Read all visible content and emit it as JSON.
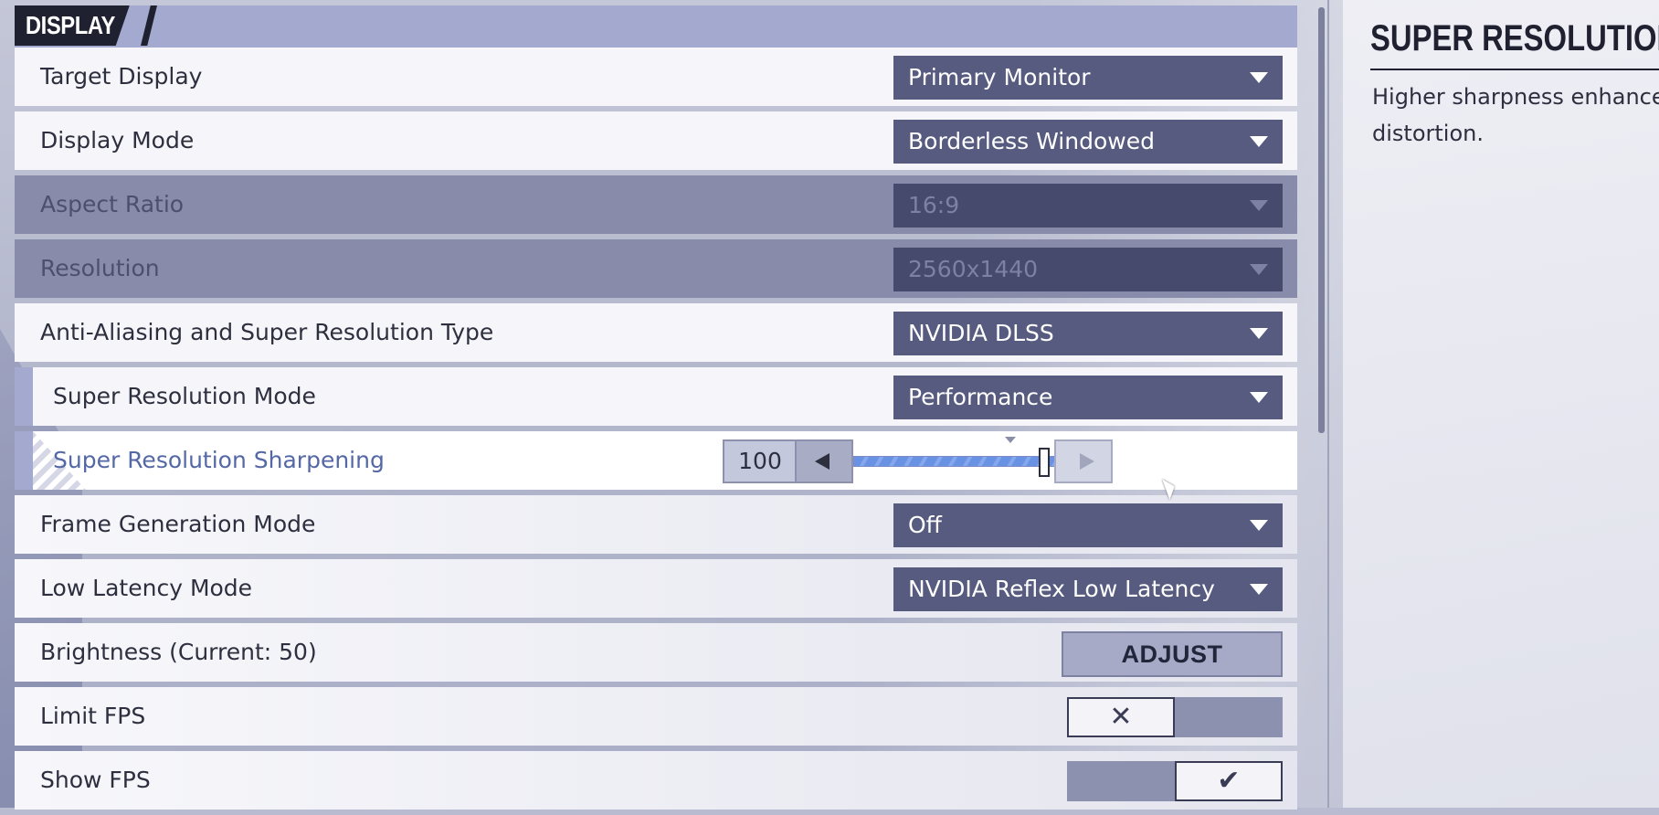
{
  "section": {
    "title": "DISPLAY"
  },
  "settings": {
    "target_display": {
      "label": "Target Display",
      "value": "Primary Monitor"
    },
    "display_mode": {
      "label": "Display Mode",
      "value": "Borderless Windowed"
    },
    "aspect_ratio": {
      "label": "Aspect Ratio",
      "value": "16:9"
    },
    "resolution": {
      "label": "Resolution",
      "value": "2560x1440"
    },
    "anti_aliasing": {
      "label": "Anti-Aliasing and Super Resolution Type",
      "value": "NVIDIA DLSS"
    },
    "super_res_mode": {
      "label": "Super Resolution Mode",
      "value": "Performance"
    },
    "super_res_sharpening": {
      "label": "Super Resolution Sharpening",
      "value": "100",
      "level": 1.0
    },
    "frame_generation": {
      "label": "Frame Generation Mode",
      "value": "Off"
    },
    "low_latency": {
      "label": "Low Latency Mode",
      "value": "NVIDIA Reflex Low Latency"
    },
    "brightness": {
      "label": "Brightness (Current: 50)",
      "button": "ADJUST"
    },
    "limit_fps": {
      "label": "Limit FPS",
      "state": false,
      "glyph": "✕"
    },
    "show_fps": {
      "label": "Show FPS",
      "state": true,
      "glyph": "✔"
    }
  },
  "info": {
    "title": "SUPER RESOLUTION S",
    "description_line1": "Higher sharpness enhances",
    "description_line2": "distortion."
  },
  "colors": {
    "dropdown_bg": "#565b7f",
    "header_dark": "#1f2130",
    "accent_label": "#5468a6",
    "slider_fill": "#6a92e4"
  }
}
